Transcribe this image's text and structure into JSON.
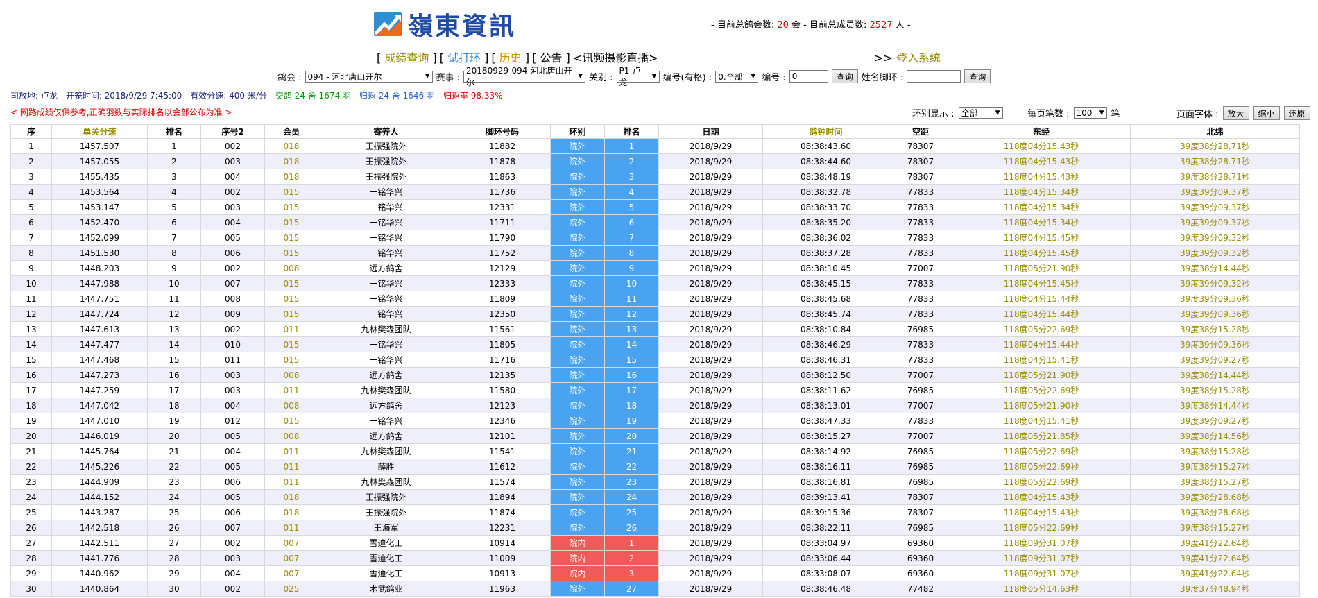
{
  "header": {
    "logo_text": "嶺東資訊",
    "stats": {
      "prefix": "- 目前总鸽会数:",
      "clubs": "20",
      "mid": "会 - 目前总成员数:",
      "members": "2527",
      "suffix": "人 -"
    },
    "nav": [
      {
        "label": "成绩查询",
        "open": "[",
        "close": "]"
      },
      {
        "label": "试打环",
        "open": "[",
        "close": "]"
      },
      {
        "label": "历史",
        "open": "[",
        "close": "]"
      },
      {
        "label": "公告",
        "open": "[",
        "close": "]"
      },
      {
        "label": "讯频摄影直播",
        "open": "<",
        "close": ">"
      }
    ],
    "login_prefix": ">>",
    "login_label": "登入系统"
  },
  "filters": {
    "club_label": "鸽会 :",
    "club_value": "094 - 河北唐山开尔",
    "race_label": "赛事 :",
    "race_value": "20180929-094-河北唐山开尔",
    "group_label": "关别 :",
    "group_value": "P1-卢龙",
    "ring_cat_label": "编号(有格) :",
    "ring_cat_value": "0.全部",
    "number_label": "编号 :",
    "number_value": "0",
    "query_label": "查询",
    "name_label": "姓名脚环 :",
    "name_value": "",
    "query2_label": "查询"
  },
  "info": {
    "release": "司放地: 卢龙 - 开笼时间: 2018/9/29 7:45:00 - 有效分速: 400 米/分 -",
    "handed": "交鸽 24 舍 1674 羽",
    "returned": "- 归返 24 舍 1646 羽 -",
    "rate": "归返率 98.33%"
  },
  "warning": "< 网路成绩仅供参考,正确羽数与实际排名以会部公布为准 >",
  "controls": {
    "ring_display_label": "环别显示 :",
    "ring_display_value": "全部",
    "per_page_label": "每页笔数 :",
    "per_page_value": "100",
    "per_page_unit": "笔",
    "font_label": "页面字体 :",
    "zoom_in": "放大",
    "zoom_out": "缩小",
    "reset": "还原"
  },
  "table": {
    "headers": [
      "序",
      "单关分速",
      "排名",
      "序号2",
      "会员",
      "寄养人",
      "脚环号码",
      "环别",
      "排名",
      "日期",
      "鸽钟时间",
      "空距",
      "东经",
      "北纬"
    ],
    "rows": [
      [
        "1",
        "1457.507",
        "1",
        "002",
        "018",
        "王振强院外",
        "11882",
        "院外",
        "1",
        "2018/9/29",
        "08:38:43.60",
        "78307",
        "118度04分15.43秒",
        "39度38分28.71秒"
      ],
      [
        "2",
        "1457.055",
        "2",
        "003",
        "018",
        "王振强院外",
        "11878",
        "院外",
        "2",
        "2018/9/29",
        "08:38:44.60",
        "78307",
        "118度04分15.43秒",
        "39度38分28.71秒"
      ],
      [
        "3",
        "1455.435",
        "3",
        "004",
        "018",
        "王振强院外",
        "11863",
        "院外",
        "3",
        "2018/9/29",
        "08:38:48.19",
        "78307",
        "118度04分15.43秒",
        "39度38分28.71秒"
      ],
      [
        "4",
        "1453.564",
        "4",
        "002",
        "015",
        "一铭华兴",
        "11736",
        "院外",
        "4",
        "2018/9/29",
        "08:38:32.78",
        "77833",
        "118度04分15.34秒",
        "39度39分09.37秒"
      ],
      [
        "5",
        "1453.147",
        "5",
        "003",
        "015",
        "一铭华兴",
        "12331",
        "院外",
        "5",
        "2018/9/29",
        "08:38:33.70",
        "77833",
        "118度04分15.34秒",
        "39度39分09.37秒"
      ],
      [
        "6",
        "1452.470",
        "6",
        "004",
        "015",
        "一铭华兴",
        "11711",
        "院外",
        "6",
        "2018/9/29",
        "08:38:35.20",
        "77833",
        "118度04分15.34秒",
        "39度39分09.37秒"
      ],
      [
        "7",
        "1452.099",
        "7",
        "005",
        "015",
        "一铭华兴",
        "11790",
        "院外",
        "7",
        "2018/9/29",
        "08:38:36.02",
        "77833",
        "118度04分15.45秒",
        "39度39分09.32秒"
      ],
      [
        "8",
        "1451.530",
        "8",
        "006",
        "015",
        "一铭华兴",
        "11752",
        "院外",
        "8",
        "2018/9/29",
        "08:38:37.28",
        "77833",
        "118度04分15.45秒",
        "39度39分09.32秒"
      ],
      [
        "9",
        "1448.203",
        "9",
        "002",
        "008",
        "远方鸽舍",
        "12129",
        "院外",
        "9",
        "2018/9/29",
        "08:38:10.45",
        "77007",
        "118度05分21.90秒",
        "39度38分14.44秒"
      ],
      [
        "10",
        "1447.988",
        "10",
        "007",
        "015",
        "一铭华兴",
        "12333",
        "院外",
        "10",
        "2018/9/29",
        "08:38:45.15",
        "77833",
        "118度04分15.45秒",
        "39度39分09.32秒"
      ],
      [
        "11",
        "1447.751",
        "11",
        "008",
        "015",
        "一铭华兴",
        "11809",
        "院外",
        "11",
        "2018/9/29",
        "08:38:45.68",
        "77833",
        "118度04分15.44秒",
        "39度39分09.36秒"
      ],
      [
        "12",
        "1447.724",
        "12",
        "009",
        "015",
        "一铭华兴",
        "12350",
        "院外",
        "12",
        "2018/9/29",
        "08:38:45.74",
        "77833",
        "118度04分15.44秒",
        "39度39分09.36秒"
      ],
      [
        "13",
        "1447.613",
        "13",
        "002",
        "011",
        "九林樊森团队",
        "11561",
        "院外",
        "13",
        "2018/9/29",
        "08:38:10.84",
        "76985",
        "118度05分22.69秒",
        "39度38分15.28秒"
      ],
      [
        "14",
        "1447.477",
        "14",
        "010",
        "015",
        "一铭华兴",
        "11805",
        "院外",
        "14",
        "2018/9/29",
        "08:38:46.29",
        "77833",
        "118度04分15.44秒",
        "39度39分09.36秒"
      ],
      [
        "15",
        "1447.468",
        "15",
        "011",
        "015",
        "一铭华兴",
        "11716",
        "院外",
        "15",
        "2018/9/29",
        "08:38:46.31",
        "77833",
        "118度04分15.41秒",
        "39度39分09.27秒"
      ],
      [
        "16",
        "1447.273",
        "16",
        "003",
        "008",
        "远方鸽舍",
        "12135",
        "院外",
        "16",
        "2018/9/29",
        "08:38:12.50",
        "77007",
        "118度05分21.90秒",
        "39度38分14.44秒"
      ],
      [
        "17",
        "1447.259",
        "17",
        "003",
        "011",
        "九林樊森团队",
        "11580",
        "院外",
        "17",
        "2018/9/29",
        "08:38:11.62",
        "76985",
        "118度05分22.69秒",
        "39度38分15.28秒"
      ],
      [
        "18",
        "1447.042",
        "18",
        "004",
        "008",
        "远方鸽舍",
        "12123",
        "院外",
        "18",
        "2018/9/29",
        "08:38:13.01",
        "77007",
        "118度05分21.90秒",
        "39度38分14.44秒"
      ],
      [
        "19",
        "1447.010",
        "19",
        "012",
        "015",
        "一铭华兴",
        "12346",
        "院外",
        "19",
        "2018/9/29",
        "08:38:47.33",
        "77833",
        "118度04分15.41秒",
        "39度39分09.27秒"
      ],
      [
        "20",
        "1446.019",
        "20",
        "005",
        "008",
        "远方鸽舍",
        "12101",
        "院外",
        "20",
        "2018/9/29",
        "08:38:15.27",
        "77007",
        "118度05分21.85秒",
        "39度38分14.56秒"
      ],
      [
        "21",
        "1445.764",
        "21",
        "004",
        "011",
        "九林樊森团队",
        "11541",
        "院外",
        "21",
        "2018/9/29",
        "08:38:14.92",
        "76985",
        "118度05分22.69秒",
        "39度38分15.28秒"
      ],
      [
        "22",
        "1445.226",
        "22",
        "005",
        "011",
        "薛胜",
        "11612",
        "院外",
        "22",
        "2018/9/29",
        "08:38:16.11",
        "76985",
        "118度05分22.69秒",
        "39度38分15.27秒"
      ],
      [
        "23",
        "1444.909",
        "23",
        "006",
        "011",
        "九林樊森团队",
        "11574",
        "院外",
        "23",
        "2018/9/29",
        "08:38:16.81",
        "76985",
        "118度05分22.69秒",
        "39度38分15.27秒"
      ],
      [
        "24",
        "1444.152",
        "24",
        "005",
        "018",
        "王振强院外",
        "11894",
        "院外",
        "24",
        "2018/9/29",
        "08:39:13.41",
        "78307",
        "118度04分15.43秒",
        "39度38分28.68秒"
      ],
      [
        "25",
        "1443.287",
        "25",
        "006",
        "018",
        "王振强院外",
        "11874",
        "院外",
        "25",
        "2018/9/29",
        "08:39:15.36",
        "78307",
        "118度04分15.43秒",
        "39度38分28.68秒"
      ],
      [
        "26",
        "1442.518",
        "26",
        "007",
        "011",
        "王海军",
        "12231",
        "院外",
        "26",
        "2018/9/29",
        "08:38:22.11",
        "76985",
        "118度05分22.69秒",
        "39度38分15.27秒"
      ],
      [
        "27",
        "1442.511",
        "27",
        "002",
        "007",
        "雪迪化工",
        "10914",
        "院内",
        "1",
        "2018/9/29",
        "08:33:04.97",
        "69360",
        "118度09分31.07秒",
        "39度41分22.64秒"
      ],
      [
        "28",
        "1441.776",
        "28",
        "003",
        "007",
        "雪迪化工",
        "11009",
        "院内",
        "2",
        "2018/9/29",
        "08:33:06.44",
        "69360",
        "118度09分31.07秒",
        "39度41分22.64秒"
      ],
      [
        "29",
        "1440.962",
        "29",
        "004",
        "007",
        "雪迪化工",
        "10913",
        "院内",
        "3",
        "2018/9/29",
        "08:33:08.07",
        "69360",
        "118度09分31.07秒",
        "39度41分22.64秒"
      ],
      [
        "30",
        "1440.864",
        "30",
        "002",
        "025",
        "术武鸽业",
        "11963",
        "院外",
        "27",
        "2018/9/29",
        "08:38:46.48",
        "77482",
        "118度05分14.63秒",
        "39度37分48.94秒"
      ]
    ]
  }
}
